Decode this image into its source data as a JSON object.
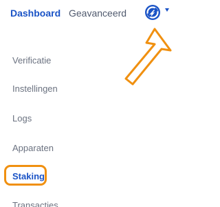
{
  "colors": {
    "active_tab": "#1a53c6",
    "inactive_tab": "#505a6e",
    "menu_text": "#6b7280",
    "menu_active": "#1a53c6",
    "logo_blue": "#1a53c6",
    "annotation_orange": "#f09010"
  },
  "header": {
    "tabs": [
      {
        "label": "Dashboard",
        "active": true
      },
      {
        "label": "Geavanceerd",
        "active": false
      }
    ],
    "account_icon": "circular-logo-icon",
    "dropdown_icon": "caret-down-icon"
  },
  "menu": {
    "items": [
      {
        "label": "Verificatie"
      },
      {
        "label": "Instellingen"
      },
      {
        "label": "Logs"
      },
      {
        "label": "Apparaten"
      },
      {
        "label": "Staking",
        "active": true
      },
      {
        "label": "Transacties"
      }
    ]
  },
  "annotations": {
    "arrow": "arrow-pointing-to-account-icon",
    "highlight": "highlight-staking"
  }
}
